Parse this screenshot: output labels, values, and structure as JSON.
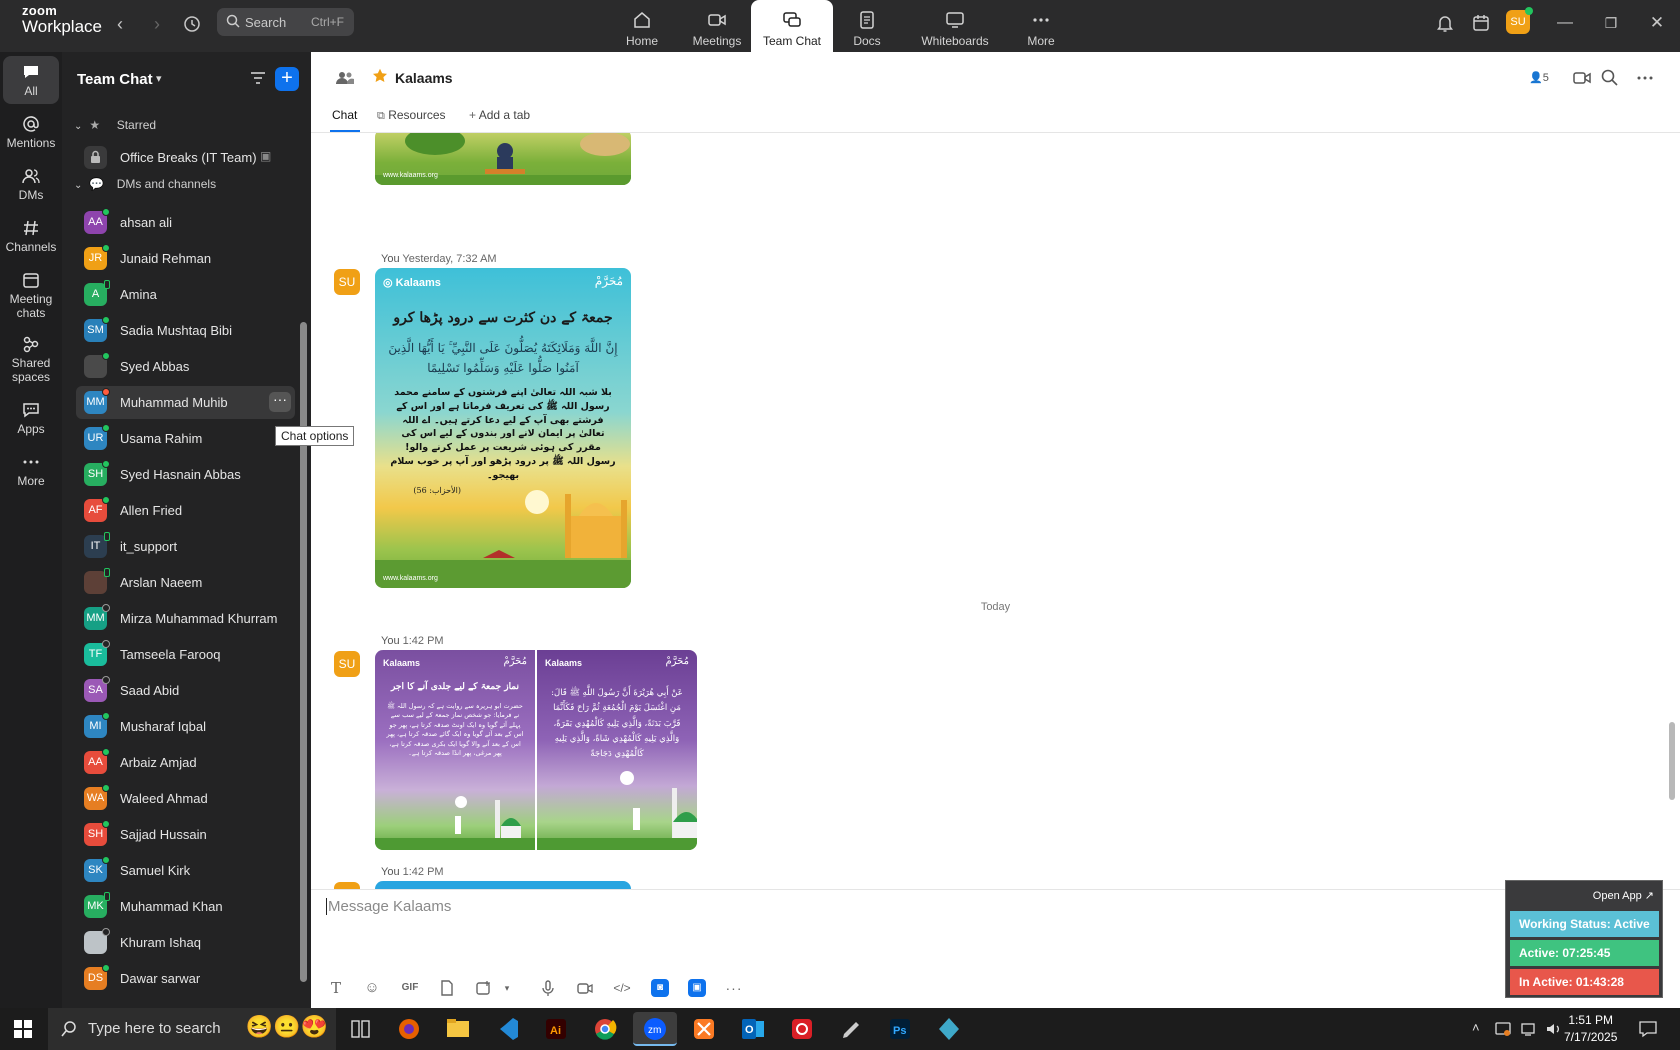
{
  "app": {
    "logo_line1": "zoom",
    "logo_line2": "Workplace"
  },
  "search": {
    "label": "Search",
    "shortcut": "Ctrl+F"
  },
  "topnav": [
    {
      "label": "Home",
      "icon": "home-icon"
    },
    {
      "label": "Meetings",
      "icon": "video-icon"
    },
    {
      "label": "Team Chat",
      "icon": "chat-icon",
      "active": true
    },
    {
      "label": "Docs",
      "icon": "doc-icon"
    },
    {
      "label": "Whiteboards",
      "icon": "whiteboard-icon"
    },
    {
      "label": "More",
      "icon": "more-icon"
    }
  ],
  "user_avatar": "SU",
  "rail": [
    {
      "label": "All",
      "icon": "chat-bubble-icon",
      "active": true
    },
    {
      "label": "Mentions",
      "icon": "at-icon"
    },
    {
      "label": "DMs",
      "icon": "people-icon"
    },
    {
      "label": "Channels",
      "icon": "hash-icon"
    },
    {
      "label": "Meeting chats",
      "icon": "calendar-icon"
    },
    {
      "label": "Shared spaces",
      "icon": "shared-icon"
    },
    {
      "label": "Apps",
      "icon": "apps-icon"
    },
    {
      "label": "More",
      "icon": "more-icon"
    }
  ],
  "sidebar": {
    "title": "Team Chat",
    "starred_label": "Starred",
    "starred_item": "Office Breaks (IT Team)",
    "dms_label": "DMs and channels",
    "dms": [
      {
        "initials": "AA",
        "name": "ahsan ali",
        "color": "#8e44ad",
        "status": "online"
      },
      {
        "initials": "JR",
        "name": "Junaid Rehman",
        "color": "#f0a016",
        "status": "online"
      },
      {
        "initials": "A",
        "name": "Amina",
        "color": "#27ae60",
        "status": "mobile"
      },
      {
        "initials": "SM",
        "name": "Sadia Mushtaq Bibi",
        "color": "#2980b9",
        "status": "online"
      },
      {
        "initials": "",
        "name": "Syed Abbas",
        "color": "#4a4a4a",
        "status": "online"
      },
      {
        "initials": "MM",
        "name": "Muhammad Muhib",
        "color": "#2e86c1",
        "status": "busy"
      },
      {
        "initials": "UR",
        "name": "Usama Rahim",
        "color": "#2e86c1",
        "status": "online"
      },
      {
        "initials": "SH",
        "name": "Syed Hasnain Abbas",
        "color": "#27ae60",
        "status": "online"
      },
      {
        "initials": "AF",
        "name": "Allen Fried",
        "color": "#e74c3c",
        "status": "online"
      },
      {
        "initials": "IT",
        "name": "it_support",
        "color": "#2c3e50",
        "status": "mobile"
      },
      {
        "initials": "",
        "name": "Arslan Naeem",
        "color": "#5d4037",
        "status": "mobile"
      },
      {
        "initials": "MM",
        "name": "Mirza Muhammad Khurram",
        "color": "#16a085",
        "status": "offline"
      },
      {
        "initials": "TF",
        "name": "Tamseela Farooq",
        "color": "#1abc9c",
        "status": "offline"
      },
      {
        "initials": "SA",
        "name": "Saad Abid",
        "color": "#9b59b6",
        "status": "offline"
      },
      {
        "initials": "MI",
        "name": "Musharaf Iqbal",
        "color": "#2e86c1",
        "status": "online"
      },
      {
        "initials": "AA",
        "name": "Arbaiz Amjad",
        "color": "#e74c3c",
        "status": "online"
      },
      {
        "initials": "WA",
        "name": "Waleed Ahmad",
        "color": "#e67e22",
        "status": "online"
      },
      {
        "initials": "SH",
        "name": "Sajjad Hussain",
        "color": "#e74c3c",
        "status": "online"
      },
      {
        "initials": "SK",
        "name": "Samuel Kirk",
        "color": "#2e86c1",
        "status": "online"
      },
      {
        "initials": "MK",
        "name": "Muhammad Khan",
        "color": "#27ae60",
        "status": "mobile"
      },
      {
        "initials": "",
        "name": "Khuram Ishaq",
        "color": "#bdc3c7",
        "status": "offline"
      },
      {
        "initials": "DS",
        "name": "Dawar sarwar",
        "color": "#e67e22",
        "status": "online"
      }
    ],
    "hover_tooltip": "Chat options"
  },
  "channel": {
    "name": "Kalaams",
    "members": "5",
    "tabs": [
      "Chat",
      "Resources",
      "Add a tab"
    ]
  },
  "messages": [
    {
      "sender": "You",
      "time": "Yesterday, 7:32 AM",
      "avatar": "SU"
    },
    {
      "sender": "You",
      "time": "1:42 PM",
      "avatar": "SU"
    },
    {
      "sender": "You",
      "time": "1:42 PM",
      "avatar": "SU"
    }
  ],
  "day_divider": "Today",
  "cards": {
    "brand": "Kalaams",
    "month": "مُحَرَّمْ",
    "card1_heading": "جمعۃ کے دن کثرت سے درود پڑھا کرو",
    "card1_arabic": "إِنَّ اللَّهَ وَمَلَائِكَتَهُ يُصَلُّونَ عَلَى النَّبِيِّ ۚ يَا أَيُّهَا الَّذِينَ آمَنُوا صَلُّوا عَلَيْهِ وَسَلِّمُوا تَسْلِيمًا",
    "card1_urdu": "بلا شبہ اللہ تعالیٰ اپنے فرشتوں کے سامنے محمد رسول اللہ ﷺ کی تعریف فرماتا ہے اور اس کے فرشتے بھی آپ کے لیے دعا کرتے ہیں۔ اے اللہ تعالیٰ پر ایمان لانے اور بندوں کے لیے اس کی مقرر کی ہوئی شریعت پر عمل کرنے والو! رسول اللہ ﷺ پر درود پڑھو اور آپ پر خوب سلام بھیجو۔",
    "card1_ref": "(الأحزاب: 56)",
    "card2_heading": "نماز جمعۃ کے لیے جلدی آنے کا اجر",
    "card2_urdu": "حضرت ابو ہریرہ سے روایت ہے کہ رسول اللہ ﷺ نے فرمایا: جو شخص نماز جمعۃ کے لیے سب سے پہلے آئے گویا وہ ایک اونٹ صدقہ کرتا ہے، پھر جو اس کے بعد آئے گویا وہ ایک گائے صدقہ کرتا ہے، پھر اس کے بعد آنے والا گویا ایک بکری صدقہ کرتا ہے، پھر مرغی، پھر انڈا صدقہ کرتا ہے۔",
    "card3_arabic": "عَنْ أَبِي هُرَيْرَةَ أَنَّ رَسُولَ اللَّهِ ﷺ قَالَ: مَنِ اغْتَسَلَ يَوْمَ الْجُمُعَةِ ثُمَّ رَاحَ فَكَأَنَّمَا قَرَّبَ بَدَنَةً، وَالَّذِي يَلِيهِ كَالْمُهْدِي بَقَرَةً، وَالَّذِي يَلِيهِ كَالْمُهْدِي شَاةً، وَالَّذِي يَلِيهِ كَالْمُهْدِي دَجَاجَةً"
  },
  "composer": {
    "placeholder": "Message Kalaams"
  },
  "composer_tools": [
    "T",
    "☺",
    "GIF",
    "file",
    "screenshot",
    "mic",
    "video",
    "</>",
    "app1",
    "app2",
    "more"
  ],
  "widget": {
    "open_app": "Open App ↗",
    "working_status": "Working Status: Active",
    "active": "Active: 07:25:45",
    "inactive": "In Active: 01:43:28",
    "colors": {
      "status": "#5bc0d6",
      "active": "#3fc380",
      "inactive": "#e8574b"
    }
  },
  "taskbar": {
    "search_placeholder": "Type here to search",
    "time": "1:51 PM",
    "date": "7/17/2025"
  },
  "colors": {
    "accent": "#0e72ed",
    "avatar_orange": "#f0a016",
    "sidebar_bg": "#232324"
  }
}
